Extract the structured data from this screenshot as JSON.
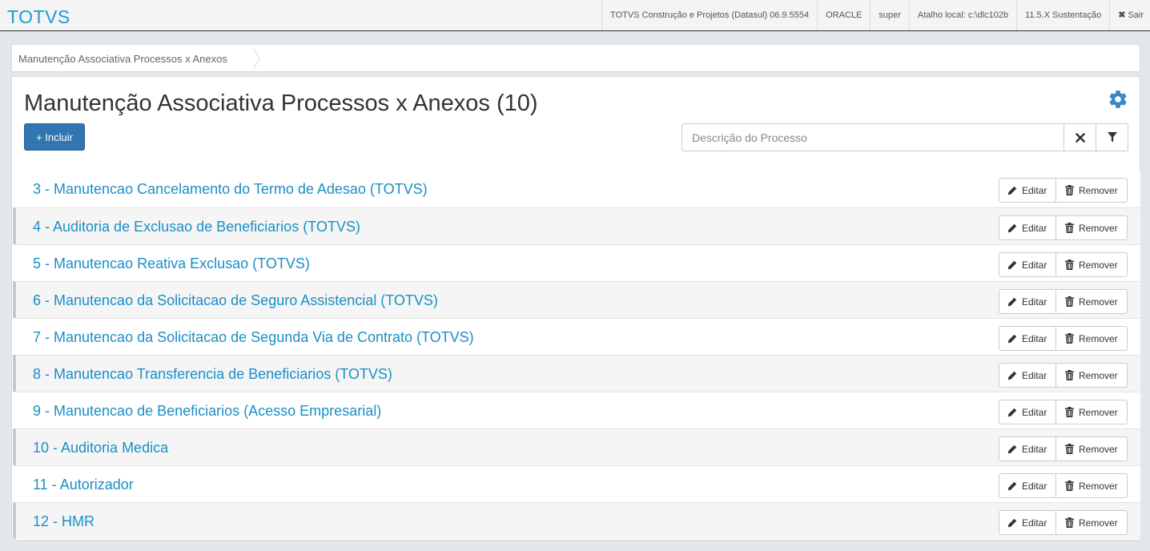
{
  "header": {
    "brand": "TOTVS",
    "info": [
      "TOTVS Construção e Projetos (Datasul) 06.9.5554",
      "ORACLE",
      "super",
      "Atalho local: c:\\dlc102b",
      "11.5.X Sustentação"
    ],
    "logout_label": "Sair"
  },
  "breadcrumb": {
    "current": "Manutenção Associativa Processos x Anexos"
  },
  "page": {
    "title": "Manutenção Associativa Processos x Anexos (10)",
    "add_button_label": "+ Incluir",
    "search_placeholder": "Descrição do Processo",
    "search_value": ""
  },
  "actions": {
    "edit_label": "Editar",
    "remove_label": "Remover"
  },
  "items": [
    "3 - Manutencao Cancelamento do Termo de Adesao (TOTVS)",
    "4 - Auditoria de Exclusao de Beneficiarios (TOTVS)",
    "5 - Manutencao Reativa Exclusao (TOTVS)",
    "6 - Manutencao da Solicitacao de Seguro Assistencial (TOTVS)",
    "7 - Manutencao da Solicitacao de Segunda Via de Contrato (TOTVS)",
    "8 - Manutencao Transferencia de Beneficiarios (TOTVS)",
    "9 - Manutencao de Beneficiarios (Acesso Empresarial)",
    "10 - Auditoria Medica",
    "11 - Autorizador",
    "12 - HMR"
  ],
  "colors": {
    "brand": "#1d9ad6",
    "link": "#1a8fc6",
    "primary_button": "#3276b1",
    "gear": "#3a87c8"
  },
  "icons": {
    "gear": "gear-icon",
    "clear": "close-icon",
    "filter": "filter-icon",
    "edit": "pencil-icon",
    "remove": "trash-icon",
    "logout": "close-icon"
  }
}
